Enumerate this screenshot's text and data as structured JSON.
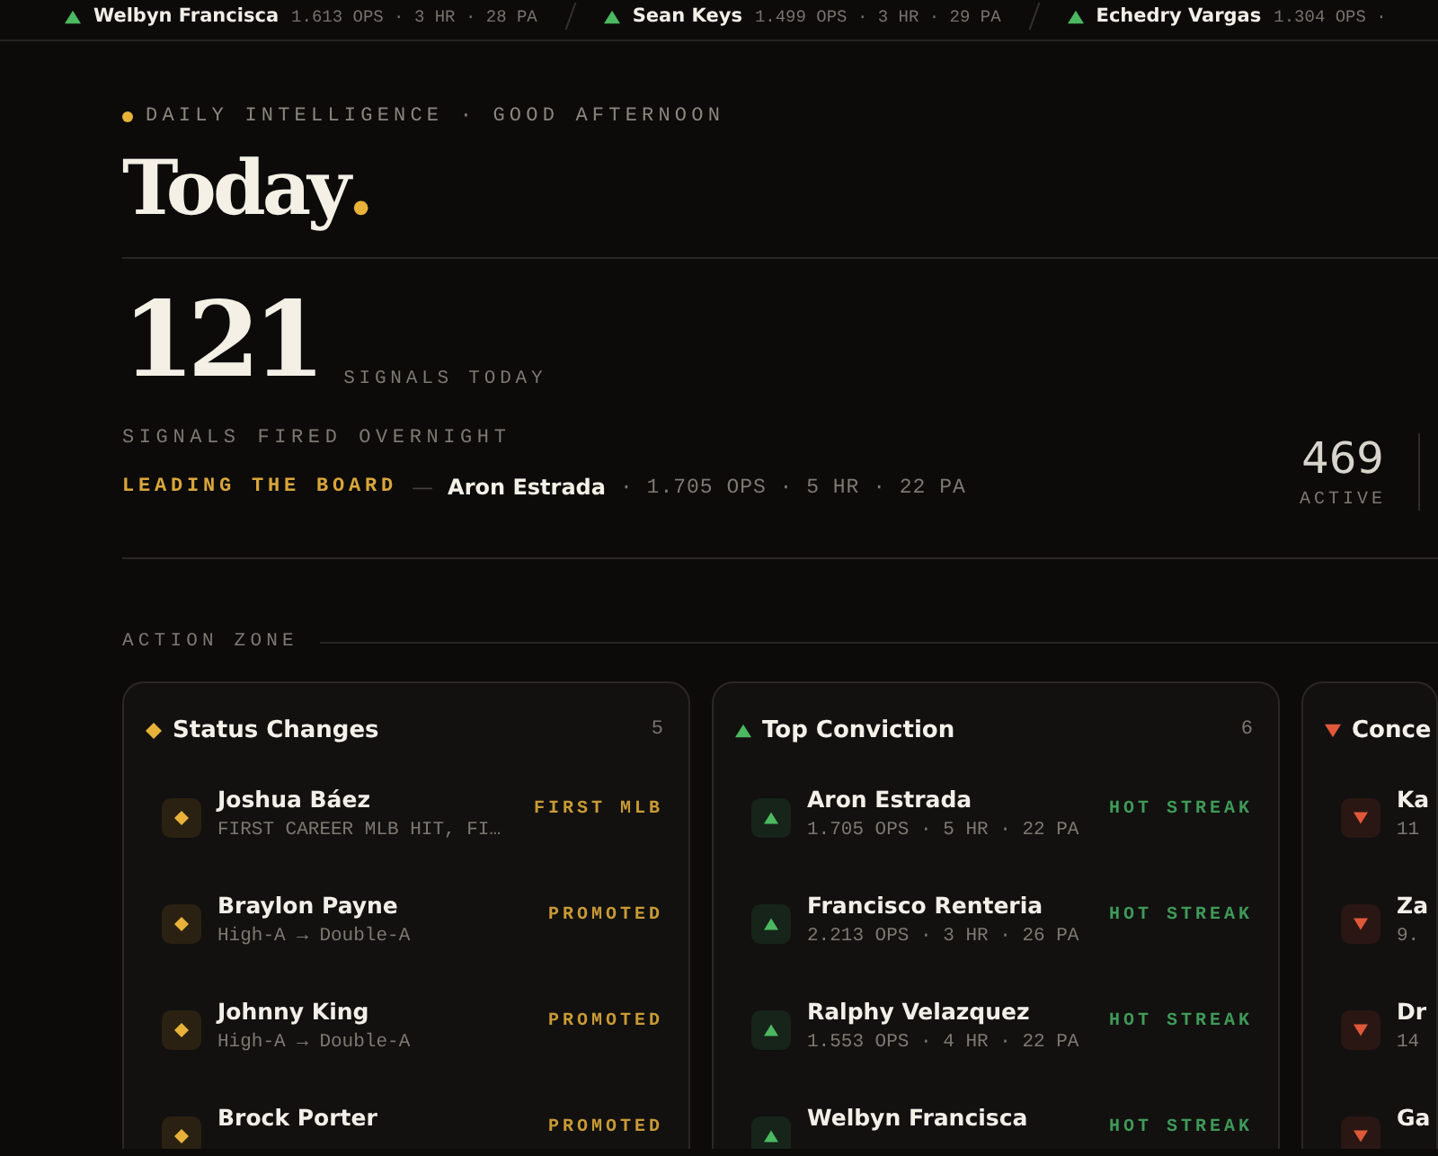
{
  "ticker": [
    {
      "kind": "up",
      "name": "Welbyn Francisca",
      "stats": "1.613 OPS · 3 HR · 28 PA"
    },
    {
      "kind": "up",
      "name": "Sean Keys",
      "stats": "1.499 OPS · 3 HR · 29 PA"
    },
    {
      "kind": "up",
      "name": "Echedry Vargas",
      "stats": "1.304 OPS ·"
    }
  ],
  "eyebrow": "DAILY INTELLIGENCE · GOOD AFTERNOON",
  "title": "Today",
  "title_mark": ".",
  "hero": {
    "count": "121",
    "count_label": "SIGNALS TODAY",
    "subtitle": "SIGNALS FIRED OVERNIGHT",
    "leader": {
      "label": "LEADING THE BOARD",
      "dash": "—",
      "name": "Aron Estrada",
      "stats": "· 1.705 OPS · 5 HR · 22 PA"
    },
    "stats": [
      {
        "value": "469",
        "label": "ACTIVE"
      }
    ]
  },
  "section_label": "ACTION ZONE",
  "cards": [
    {
      "kind": "status",
      "title": "Status Changes",
      "count": "5",
      "items": [
        {
          "name": "Joshua Báez",
          "detail": "FIRST CAREER MLB HIT, FI…",
          "tag": "FIRST MLB"
        },
        {
          "name": "Braylon Payne",
          "detail": "High-A → Double-A",
          "tag": "PROMOTED"
        },
        {
          "name": "Johnny King",
          "detail": "High-A → Double-A",
          "tag": "PROMOTED"
        },
        {
          "name": "Brock Porter",
          "tag": "PROMOTED"
        }
      ]
    },
    {
      "kind": "up",
      "title": "Top Conviction",
      "count": "6",
      "items": [
        {
          "name": "Aron Estrada",
          "detail": "1.705 OPS · 5 HR · 22 PA",
          "tag": "HOT STREAK"
        },
        {
          "name": "Francisco Renteria",
          "detail": "2.213 OPS · 3 HR · 26 PA",
          "tag": "HOT STREAK"
        },
        {
          "name": "Ralphy Velazquez",
          "detail": "1.553 OPS · 4 HR · 22 PA",
          "tag": "HOT STREAK"
        },
        {
          "name": "Welbyn Francisca",
          "tag": "HOT STREAK"
        }
      ]
    },
    {
      "kind": "down",
      "title": "Conce",
      "items": [
        {
          "name": "Ka",
          "detail": "11"
        },
        {
          "name": "Za",
          "detail": "9."
        },
        {
          "name": "Dr",
          "detail": "14"
        },
        {
          "name": "Ga"
        }
      ]
    }
  ]
}
